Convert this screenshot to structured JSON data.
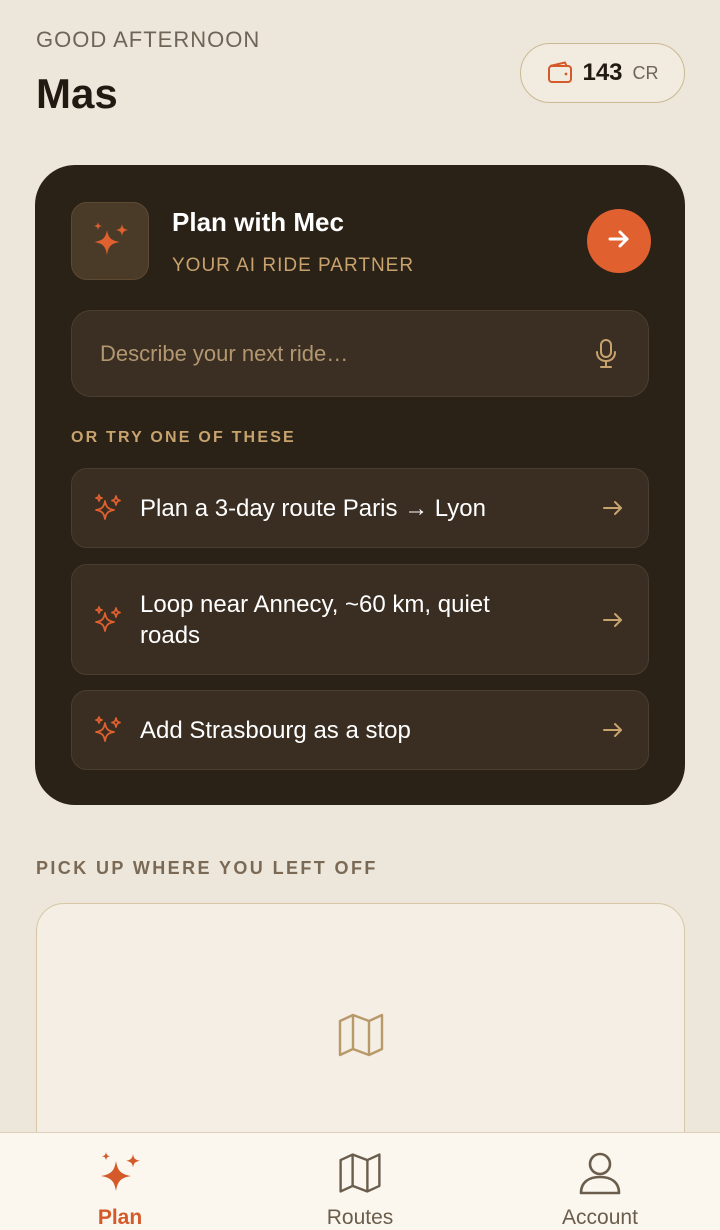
{
  "header": {
    "greeting": "GOOD AFTERNOON",
    "username": "Mas",
    "credits": {
      "amount": "143",
      "unit": "CR",
      "icon": "wallet-icon"
    }
  },
  "ai_card": {
    "title": "Plan with Mec",
    "subtitle": "YOUR AI RIDE PARTNER",
    "logo_icon": "sparkles-icon",
    "go_icon": "arrow-right-icon",
    "input": {
      "placeholder": "Describe your next ride…",
      "value": "",
      "icon": "microphone-icon"
    },
    "suggestions_heading": "OR TRY ONE OF THESE",
    "suggestions": [
      {
        "label": "Plan a 3-day route Paris → Lyon"
      },
      {
        "label": "Loop near Annecy, ~60 km, quiet roads"
      },
      {
        "label": "Add Strasbourg as a stop"
      }
    ]
  },
  "resume": {
    "heading": "PICK UP WHERE YOU LEFT OFF",
    "icon": "map-icon"
  },
  "tabbar": {
    "tabs": [
      {
        "label": "Plan",
        "icon": "sparkles-icon",
        "active": true
      },
      {
        "label": "Routes",
        "icon": "map-icon",
        "active": false
      },
      {
        "label": "Account",
        "icon": "user-icon",
        "active": false
      }
    ]
  },
  "colors": {
    "background": "#ede6da",
    "card_dark": "#2a2117",
    "accent": "#e0602f",
    "accent_text": "#c9a36e",
    "tab_active": "#d45a2a"
  }
}
